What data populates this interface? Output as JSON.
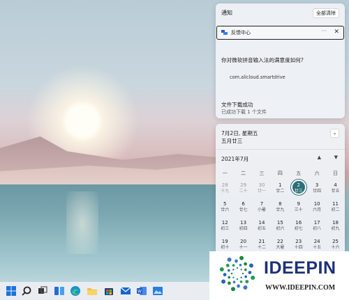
{
  "notifications": {
    "header": "通知",
    "clear_all": "全部清除",
    "app_name": "反馈中心",
    "more_label": "···",
    "close_label": "✕",
    "question": "你对微软拼音输入法的满意度如何?",
    "package": "com.alicloud.smartdrive",
    "download_title": "文件下载成功",
    "download_sub": "已成功下载 1 个文件"
  },
  "calendar": {
    "date_text": "7月2日, 星期五",
    "lunar_text": "五月廿三",
    "month_label": "2021年7月",
    "collapse_icon": "⌄",
    "prev_icon": "▲",
    "next_icon": "▼",
    "weekdays": [
      "一",
      "二",
      "三",
      "四",
      "五",
      "六",
      "日"
    ],
    "weeks": [
      [
        {
          "d": "28",
          "l": "十九",
          "m": true
        },
        {
          "d": "29",
          "l": "二十",
          "m": true
        },
        {
          "d": "30",
          "l": "廿一",
          "m": true
        },
        {
          "d": "1",
          "l": "廿二"
        },
        {
          "d": "2",
          "l": "廿三",
          "today": true
        },
        {
          "d": "3",
          "l": "廿四"
        },
        {
          "d": "4",
          "l": "廿五"
        }
      ],
      [
        {
          "d": "5",
          "l": "廿六"
        },
        {
          "d": "6",
          "l": "廿七"
        },
        {
          "d": "7",
          "l": "小暑"
        },
        {
          "d": "8",
          "l": "廿九"
        },
        {
          "d": "9",
          "l": "三十"
        },
        {
          "d": "10",
          "l": "六月"
        },
        {
          "d": "11",
          "l": "初二"
        }
      ],
      [
        {
          "d": "12",
          "l": "初三"
        },
        {
          "d": "13",
          "l": "初四"
        },
        {
          "d": "14",
          "l": "初五"
        },
        {
          "d": "15",
          "l": "初六"
        },
        {
          "d": "16",
          "l": "初七"
        },
        {
          "d": "17",
          "l": "初八"
        },
        {
          "d": "18",
          "l": "初九"
        }
      ],
      [
        {
          "d": "19",
          "l": "初十"
        },
        {
          "d": "20",
          "l": "十一"
        },
        {
          "d": "21",
          "l": "十二"
        },
        {
          "d": "22",
          "l": "大暑"
        },
        {
          "d": "23",
          "l": "十四"
        },
        {
          "d": "24",
          "l": "十五"
        },
        {
          "d": "25",
          "l": "十六"
        }
      ]
    ]
  },
  "taskbar": {
    "items": [
      "windows-start-icon",
      "search-icon",
      "task-view-icon",
      "widgets-icon",
      "edge-browser-icon",
      "file-explorer-icon",
      "store-icon",
      "mail-icon",
      "word-icon",
      "photos-icon"
    ]
  },
  "watermark": {
    "title": "IDEEPIN",
    "url": "WWW.IDEEPIN.COM"
  },
  "colors": {
    "accent": "#2b6f78",
    "panel_bg": "#eef1f6"
  }
}
